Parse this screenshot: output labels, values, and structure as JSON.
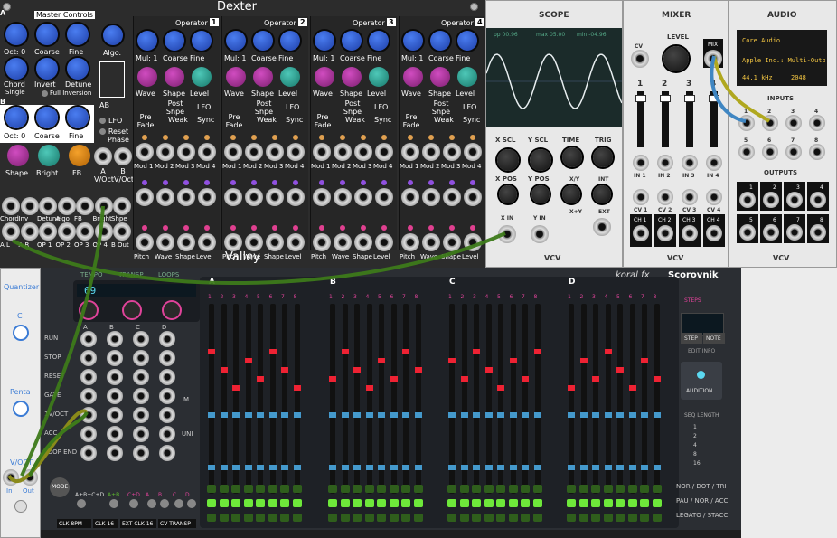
{
  "dexter": {
    "title": "Dexter",
    "brand": "Valley",
    "master_label": "Master Controls",
    "a": "A",
    "b": "B",
    "row1": [
      "Oct: 0",
      "Coarse",
      "Fine"
    ],
    "row2": [
      "Chord",
      "Invert",
      "Detune"
    ],
    "chord_sub": "Single",
    "full_inversion": "Full Inversion",
    "rowb": [
      "Oct: 0",
      "Coarse",
      "Fine"
    ],
    "algo": "Algo.",
    "ab": "AB",
    "lfo": "LFO",
    "reset_phase": "Reset Phase",
    "shape_row": [
      "Shape",
      "Bright",
      "FB"
    ],
    "a_voct": "A V/Oct",
    "b_voct": "B V/Oct",
    "cv_row1": [
      "Chord",
      "Inv",
      "Detune",
      "Algo",
      "FB",
      "Bright",
      "Shpe"
    ],
    "cv_row2": [
      "A L",
      "A R",
      "OP 1",
      "OP 2",
      "OP 3",
      "OP 4",
      "B Out"
    ],
    "operators": [
      {
        "title": "Operator",
        "num": "1"
      },
      {
        "title": "Operator",
        "num": "2"
      },
      {
        "title": "Operator",
        "num": "3"
      },
      {
        "title": "Operator",
        "num": "4"
      }
    ],
    "op_row1": [
      "Mul: 1",
      "Coarse",
      "Fine"
    ],
    "op_row2": [
      "Wave",
      "Shape",
      "Level"
    ],
    "op_opts": [
      "Pre Fade",
      "Post Shpe",
      "LFO",
      "Weak",
      "Sync"
    ],
    "op_mod": [
      "Mod 1",
      "Mod 2",
      "Mod 3",
      "Mod 4"
    ],
    "op_bottom": [
      "Pitch",
      "Wave",
      "Shape",
      "Level"
    ]
  },
  "scope": {
    "title": "SCOPE",
    "readout": [
      "pp 00.96",
      "max 05.00",
      "min -04.96"
    ],
    "labels": [
      "X SCL",
      "Y SCL",
      "TIME",
      "TRIG",
      "X POS",
      "Y POS",
      "X IN",
      "Y IN"
    ],
    "mode": [
      "X/Y",
      "X+Y"
    ],
    "trig_src": [
      "INT",
      "EXT"
    ],
    "brand": "VCV"
  },
  "mixer": {
    "title": "MIXER",
    "level": "LEVEL",
    "cv": "CV",
    "mix": "MIX",
    "channels": [
      "1",
      "2",
      "3",
      "4"
    ],
    "in": [
      "IN 1",
      "IN 2",
      "IN 3",
      "IN 4"
    ],
    "cvs": [
      "CV 1",
      "CV 2",
      "CV 3",
      "CV 4"
    ],
    "ch": [
      "CH 1",
      "CH 2",
      "CH 3",
      "CH 4"
    ],
    "brand": "VCV"
  },
  "audio": {
    "title": "AUDIO",
    "display": [
      "Core Audio",
      "Apple Inc.: Multi-Output",
      "44.1 kHz",
      "2048"
    ],
    "inputs": "INPUTS",
    "outputs": "OUTPUTS",
    "nums": [
      "1",
      "2",
      "3",
      "4",
      "5",
      "6",
      "7",
      "8"
    ],
    "brand": "VCV"
  },
  "quantizer": {
    "title": "Quantizer",
    "root": "C",
    "scale": "Penta",
    "voct": "V/OCT",
    "in": "In",
    "out": "Out"
  },
  "scorovnik": {
    "brand": "koral fx",
    "name": "Scorovnik",
    "display": "69",
    "tempo": "TEMPO",
    "transp": "TRANSP",
    "loops": "LOOPS",
    "cols": [
      "A",
      "B",
      "C",
      "D"
    ],
    "rows": [
      "RUN",
      "STOP",
      "RESET",
      "GATE",
      "1V/OCT",
      "ACC",
      "LOOP END"
    ],
    "m": "M",
    "uni": "UNI",
    "mode": "MODE",
    "mode_labels": [
      "A+B+C+D",
      "A+B",
      "C+D",
      "A",
      "B",
      "C",
      "D"
    ],
    "bottom_buttons": [
      "CLK 8PM",
      "CLK 16",
      "EXT CLK 16",
      "CV TRANSP"
    ],
    "steps_label": "STEPS",
    "step": "STEP",
    "note": "NOTE",
    "edit_info": "EDIT INFO",
    "audition": "AUDITION",
    "seq_length": "SEQ LENGTH",
    "lengths": [
      "1",
      "2",
      "4",
      "8",
      "16"
    ],
    "legend": [
      "NOR / DOT / TRI",
      "PAU / NOR / ACC",
      "LEGATO / STACC"
    ],
    "section_labels": [
      "A",
      "B",
      "C",
      "D"
    ],
    "step_nums": [
      "1",
      "2",
      "3",
      "4",
      "5",
      "6",
      "7",
      "8"
    ]
  }
}
